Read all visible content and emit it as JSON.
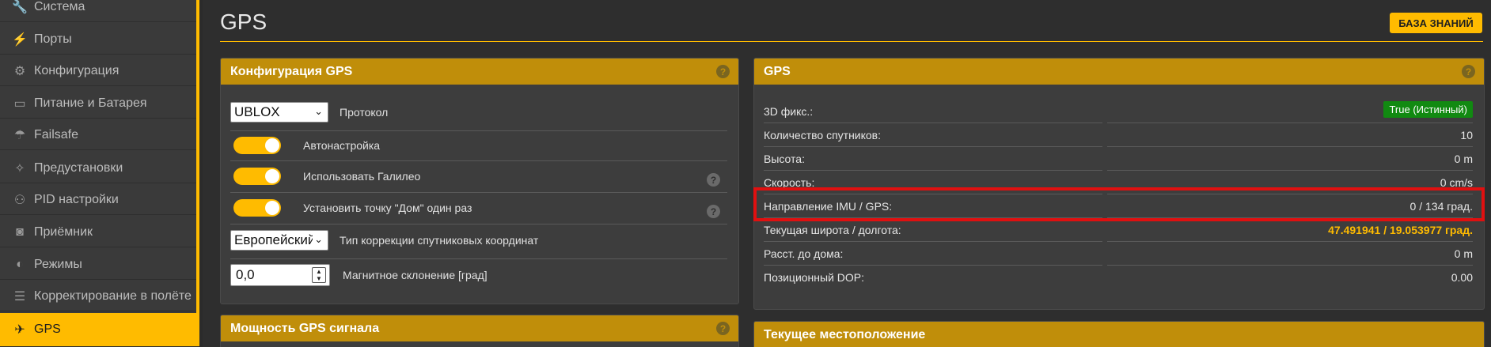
{
  "sidebar": {
    "items": [
      {
        "label": "Система",
        "icon": "wrench-icon",
        "glyph": "🔧"
      },
      {
        "label": "Порты",
        "icon": "plug-icon",
        "glyph": "⚡"
      },
      {
        "label": "Конфигурация",
        "icon": "gear-icon",
        "glyph": "⚙"
      },
      {
        "label": "Питание и Батарея",
        "icon": "battery-icon",
        "glyph": "▭"
      },
      {
        "label": "Failsafe",
        "icon": "parachute-icon",
        "glyph": "☂"
      },
      {
        "label": "Предустановки",
        "icon": "magic-wand-icon",
        "glyph": "✧"
      },
      {
        "label": "PID настройки",
        "icon": "hierarchy-icon",
        "glyph": "⚇"
      },
      {
        "label": "Приёмник",
        "icon": "robot-icon",
        "glyph": "◙"
      },
      {
        "label": "Режимы",
        "icon": "toggle-icon",
        "glyph": "◐"
      },
      {
        "label": "Корректирование в полёте",
        "icon": "sliders-icon",
        "glyph": "☰"
      },
      {
        "label": "GPS",
        "icon": "satellite-icon",
        "glyph": "✈"
      }
    ]
  },
  "header": {
    "title": "GPS",
    "kb_button": "БАЗА ЗНАНИЙ"
  },
  "gps_config": {
    "title": "Конфигурация GPS",
    "help": "?",
    "protocol_value": "UBLOX",
    "protocol_label": "Протокол",
    "auto_config_label": "Автонастройка",
    "galileo_label": "Использовать Галилео",
    "home_once_label": "Установить точку \"Дом\" один раз",
    "correction_value": "Европейский",
    "correction_label": "Тип коррекции спутниковых координат",
    "mag_decl_value": "0,0",
    "mag_decl_label": "Магнитное склонение [град]"
  },
  "gps_status": {
    "title": "GPS",
    "help": "?",
    "rows": [
      {
        "label": "3D фикс.:",
        "value": "True (Истинный)"
      },
      {
        "label": "Количество спутников:",
        "value": "10"
      },
      {
        "label": "Высота:",
        "value": "0 m"
      },
      {
        "label": "Скорость:",
        "value": "0 cm/s"
      },
      {
        "label": "Направление IMU / GPS:",
        "value": "0 / 134 град."
      },
      {
        "label": "Текущая широта / долгота:",
        "value": "47.491941 / 19.053977 град."
      },
      {
        "label": "Расст. до дома:",
        "value": "0 m"
      },
      {
        "label": "Позиционный DOP:",
        "value": "0.00"
      }
    ]
  },
  "signal_panel": {
    "title": "Мощность GPS сигнала",
    "help": "?"
  },
  "location_panel": {
    "title": "Текущее местоположение"
  },
  "colors": {
    "accent": "#ffbb00",
    "panel_head": "#c08e0a",
    "fix_badge": "#118a11",
    "highlight": "#e01010"
  }
}
